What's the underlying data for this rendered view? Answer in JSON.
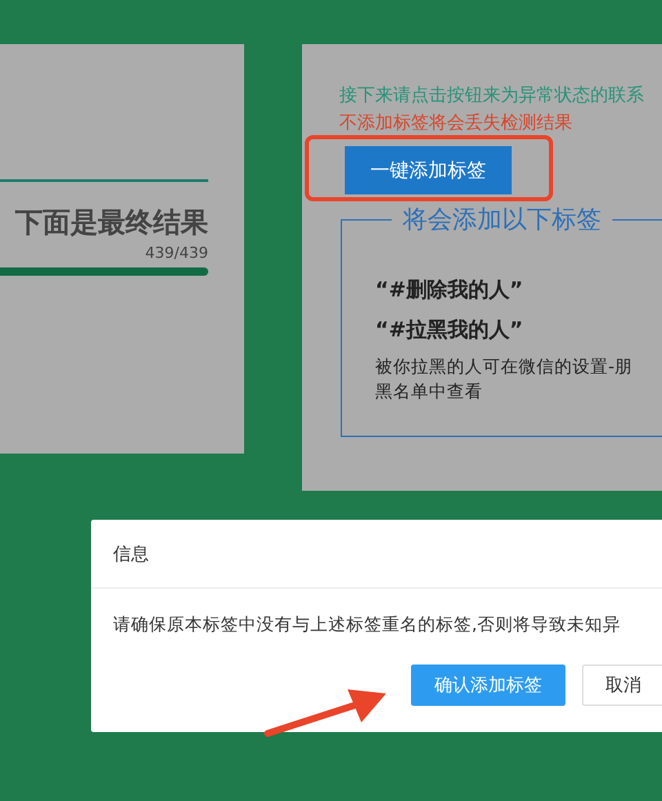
{
  "result_card": {
    "title": "下面是最终结果",
    "count": "439/439",
    "progress": {
      "level": 1
    }
  },
  "tag_card": {
    "instruction": "接下来请点击按钮来为异常状态的联系",
    "warning": "不添加标签将会丢失检测结果",
    "add_button": "一键添加标签",
    "tag_box": {
      "legend": "将会添加以下标签",
      "tags": [
        "“#删除我的人”",
        "“#拉黑我的人”"
      ],
      "note_lines": [
        "被你拉黑的人可在微信的设置-朋",
        "黑名单中查看"
      ]
    }
  },
  "dialog": {
    "title": "信息",
    "message": "请确保原本标签中没有与上述标签重名的标签,否则将导致未知异",
    "buttons": [
      {
        "label": "确认添加标签",
        "kind": "primary"
      },
      {
        "label": "取消",
        "kind": "default"
      }
    ]
  }
}
